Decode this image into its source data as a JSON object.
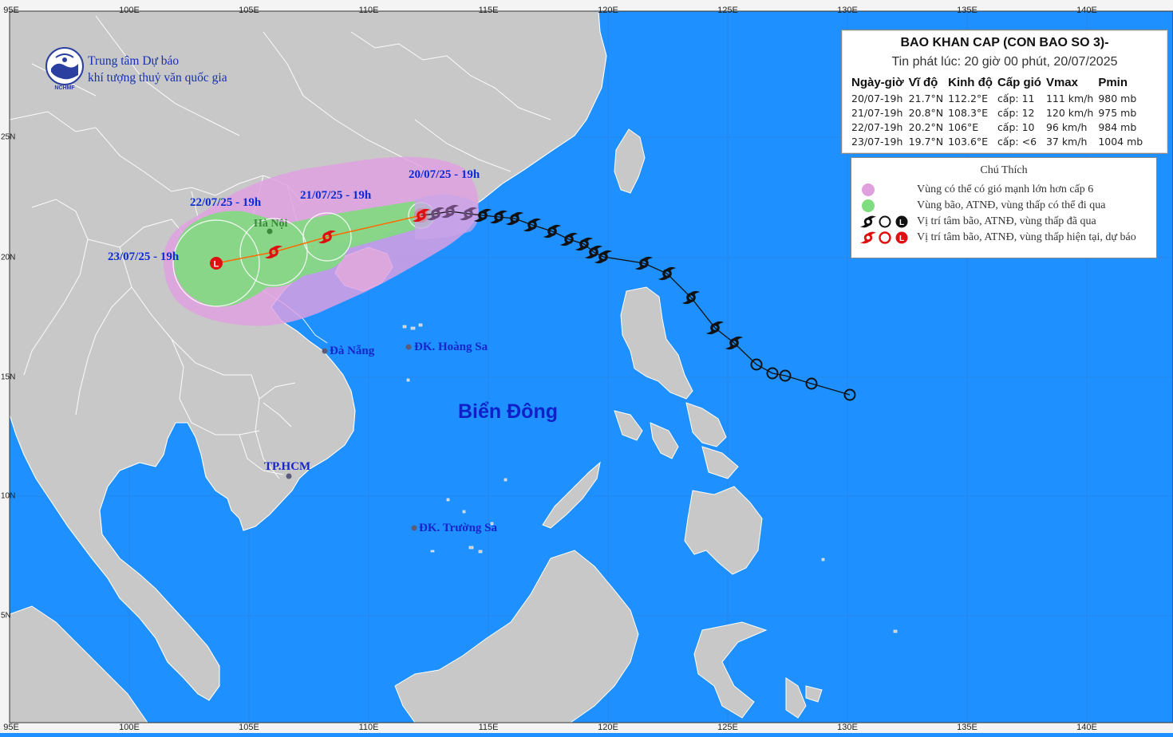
{
  "map": {
    "lon_labels_top": [
      "95E",
      "100E",
      "105E",
      "110E",
      "115E",
      "120E",
      "125E",
      "130E",
      "135E",
      "140E"
    ],
    "lon_labels_bottom": [
      "95E",
      "100E",
      "105E",
      "110E",
      "115E",
      "120E",
      "125E",
      "130E",
      "135E",
      "140E"
    ],
    "lat_labels": [
      "25N",
      "20N",
      "15N",
      "10N",
      "5N"
    ],
    "colors": {
      "sea": "#1e90ff",
      "land": "#c8c8c8",
      "strong_wind_zone": "#d9a3d9",
      "storm_zone": "#7cdc7c",
      "forecast_track": "#ff6600"
    }
  },
  "logo": {
    "line1": "Trung tâm Dự báo",
    "line2": "khí tượng thuỷ văn quốc gia",
    "emblem_text": "NCHMF"
  },
  "track": {
    "forecast_points": [
      {
        "label": "20/07/25 - 19h",
        "type": "storm"
      },
      {
        "label": "21/07/25 - 19h",
        "type": "storm"
      },
      {
        "label": "22/07/25 - 19h",
        "type": "storm"
      },
      {
        "label": "23/07/25 - 19h",
        "type": "low"
      }
    ],
    "low_symbol": "L"
  },
  "places": {
    "hanoi": "Hà Nội",
    "danang": "Đà Nẵng",
    "hoangsa": "ĐK. Hoàng Sa",
    "hcm": "TP.HCM",
    "truongsa": "ĐK. Trường Sa",
    "sea": "Biển Đông"
  },
  "info": {
    "title": "BAO KHAN CAP (CON BAO SO 3)-",
    "issued": "Tin phát lúc: 20 giờ 00 phút, 20/07/2025",
    "headers": [
      "Ngày-giờ",
      "Vĩ độ",
      "Kinh độ",
      "Cấp gió",
      "Vmax",
      "Pmin"
    ],
    "rows": [
      [
        "20/07-19h",
        "21.7°N",
        "112.2°E",
        "cấp: 11",
        "111 km/h",
        "980 mb"
      ],
      [
        "21/07-19h",
        "20.8°N",
        "108.3°E",
        "cấp: 12",
        "120 km/h",
        "975 mb"
      ],
      [
        "22/07-19h",
        "20.2°N",
        "106°E",
        "cấp: 10",
        "96 km/h",
        "984 mb"
      ],
      [
        "23/07-19h",
        "19.7°N",
        "103.6°E",
        "cấp: <6",
        "37 km/h",
        "1004 mb"
      ]
    ]
  },
  "legend": {
    "title": "Chú Thích",
    "items": [
      "Vùng có thể có gió mạnh lớn hơn cấp 6",
      "Vùng bão, ATNĐ, vùng thấp có thể đi qua",
      "Vị trí tâm bão, ATNĐ, vùng thấp đã qua",
      "Vị trí tâm bão, ATNĐ, vùng thấp hiện tại, dự báo"
    ],
    "symbol_low": "L"
  }
}
